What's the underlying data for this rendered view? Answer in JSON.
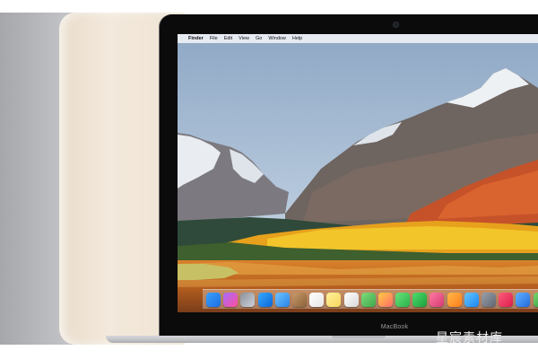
{
  "menubar": {
    "apple_symbol": "",
    "items": [
      "Finder",
      "File",
      "Edit",
      "View",
      "Go",
      "Window",
      "Help"
    ]
  },
  "laptop": {
    "brand": "MacBook"
  },
  "watermark": "星宸素材库",
  "dock": {
    "icons": [
      "finder-icon",
      "siri-icon",
      "launchpad-icon",
      "safari-icon",
      "mail-icon",
      "contacts-icon",
      "calendar-icon",
      "notes-icon",
      "reminders-icon",
      "maps-icon",
      "photos-icon",
      "messages-icon",
      "facetime-icon",
      "itunes-icon",
      "ibooks-icon",
      "app-store-icon",
      "system-preferences-icon",
      "music-icon",
      "keynote-icon",
      "numbers-icon",
      "pages-icon",
      "trash-icon"
    ]
  },
  "colors": {
    "sky": "#9fb7cf",
    "forest": "#e7a11c",
    "lake": "#b65f1f"
  }
}
